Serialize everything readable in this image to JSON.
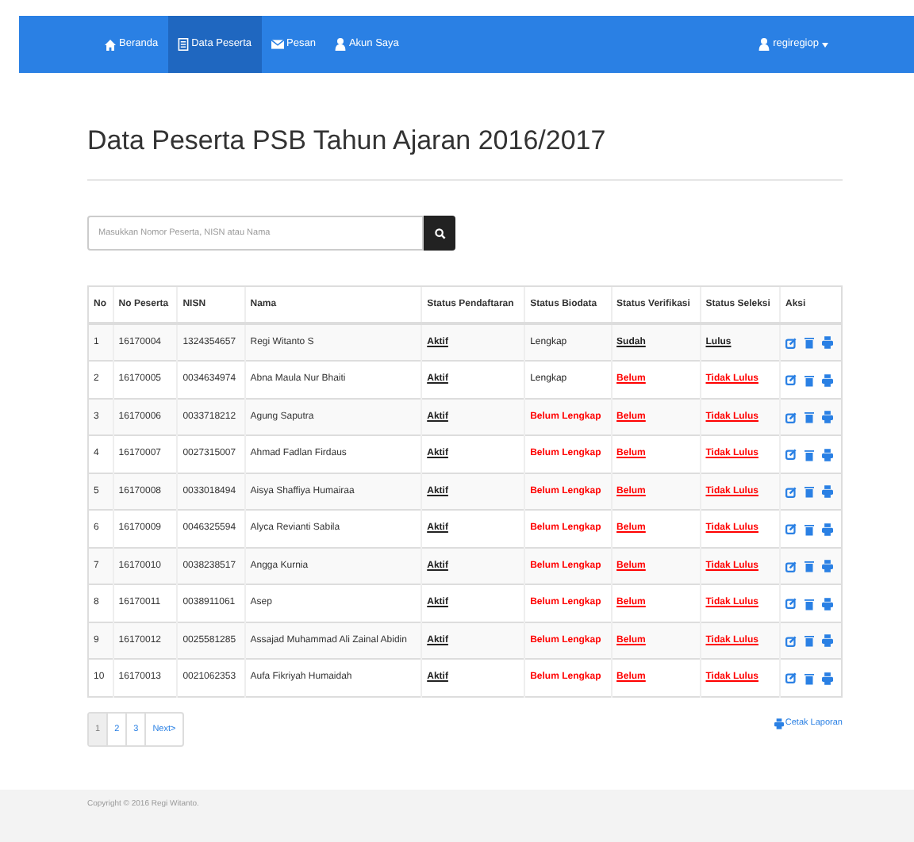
{
  "navbar": {
    "items": [
      {
        "label": "Beranda",
        "selected": false
      },
      {
        "label": "Data Peserta",
        "selected": true
      },
      {
        "label": "Pesan",
        "selected": false
      },
      {
        "label": "Akun Saya",
        "selected": false
      }
    ],
    "user_menu": {
      "label": "regiregiop"
    }
  },
  "title": "Data Peserta PSB Tahun Ajaran 2016/2017",
  "search": {
    "placeholder": "Masukkan Nomor Peserta, NISN atau Nama"
  },
  "table": {
    "columns": [
      "No",
      "No Peserta",
      "NISN",
      "Nama",
      "Status Pendaftaran",
      "Status Biodata",
      "Status Verifikasi",
      "Status Seleksi",
      "Aksi"
    ],
    "rows": [
      {
        "no": "1",
        "no_peserta": "16170004",
        "nisn": "1324354657",
        "nama": "Regi Witanto S",
        "pendaftaran": {
          "text": "Aktif",
          "ok": true
        },
        "biodata": {
          "text": "Lengkap",
          "ok": true
        },
        "verifikasi": {
          "text": "Sudah",
          "ok": true
        },
        "seleksi": {
          "text": "Lulus",
          "ok": true
        }
      },
      {
        "no": "2",
        "no_peserta": "16170005",
        "nisn": "0034634974",
        "nama": "Abna Maula Nur Bhaiti",
        "pendaftaran": {
          "text": "Aktif",
          "ok": true
        },
        "biodata": {
          "text": "Lengkap",
          "ok": true
        },
        "verifikasi": {
          "text": "Belum",
          "ok": false
        },
        "seleksi": {
          "text": "Tidak Lulus",
          "ok": false
        }
      },
      {
        "no": "3",
        "no_peserta": "16170006",
        "nisn": "0033718212",
        "nama": "Agung Saputra",
        "pendaftaran": {
          "text": "Aktif",
          "ok": true
        },
        "biodata": {
          "text": "Belum Lengkap",
          "ok": false
        },
        "verifikasi": {
          "text": "Belum",
          "ok": false
        },
        "seleksi": {
          "text": "Tidak Lulus",
          "ok": false
        }
      },
      {
        "no": "4",
        "no_peserta": "16170007",
        "nisn": "0027315007",
        "nama": "Ahmad Fadlan Firdaus",
        "pendaftaran": {
          "text": "Aktif",
          "ok": true
        },
        "biodata": {
          "text": "Belum Lengkap",
          "ok": false
        },
        "verifikasi": {
          "text": "Belum",
          "ok": false
        },
        "seleksi": {
          "text": "Tidak Lulus",
          "ok": false
        }
      },
      {
        "no": "5",
        "no_peserta": "16170008",
        "nisn": "0033018494",
        "nama": "Aisya Shaffiya Humairaa",
        "pendaftaran": {
          "text": "Aktif",
          "ok": true
        },
        "biodata": {
          "text": "Belum Lengkap",
          "ok": false
        },
        "verifikasi": {
          "text": "Belum",
          "ok": false
        },
        "seleksi": {
          "text": "Tidak Lulus",
          "ok": false
        }
      },
      {
        "no": "6",
        "no_peserta": "16170009",
        "nisn": "0046325594",
        "nama": "Alyca Revianti Sabila",
        "pendaftaran": {
          "text": "Aktif",
          "ok": true
        },
        "biodata": {
          "text": "Belum Lengkap",
          "ok": false
        },
        "verifikasi": {
          "text": "Belum",
          "ok": false
        },
        "seleksi": {
          "text": "Tidak Lulus",
          "ok": false
        }
      },
      {
        "no": "7",
        "no_peserta": "16170010",
        "nisn": "0038238517",
        "nama": "Angga Kurnia",
        "pendaftaran": {
          "text": "Aktif",
          "ok": true
        },
        "biodata": {
          "text": "Belum Lengkap",
          "ok": false
        },
        "verifikasi": {
          "text": "Belum",
          "ok": false
        },
        "seleksi": {
          "text": "Tidak Lulus",
          "ok": false
        }
      },
      {
        "no": "8",
        "no_peserta": "16170011",
        "nisn": "0038911061",
        "nama": "Asep",
        "pendaftaran": {
          "text": "Aktif",
          "ok": true
        },
        "biodata": {
          "text": "Belum Lengkap",
          "ok": false
        },
        "verifikasi": {
          "text": "Belum",
          "ok": false
        },
        "seleksi": {
          "text": "Tidak Lulus",
          "ok": false
        }
      },
      {
        "no": "9",
        "no_peserta": "16170012",
        "nisn": "0025581285",
        "nama": "Assajad Muhammad Ali Zainal Abidin",
        "pendaftaran": {
          "text": "Aktif",
          "ok": true
        },
        "biodata": {
          "text": "Belum Lengkap",
          "ok": false
        },
        "verifikasi": {
          "text": "Belum",
          "ok": false
        },
        "seleksi": {
          "text": "Tidak Lulus",
          "ok": false
        }
      },
      {
        "no": "10",
        "no_peserta": "16170013",
        "nisn": "0021062353",
        "nama": "Aufa Fikriyah Humaidah",
        "pendaftaran": {
          "text": "Aktif",
          "ok": true
        },
        "biodata": {
          "text": "Belum Lengkap",
          "ok": false
        },
        "verifikasi": {
          "text": "Belum",
          "ok": false
        },
        "seleksi": {
          "text": "Tidak Lulus",
          "ok": false
        }
      }
    ]
  },
  "pagination": [
    {
      "label": "1",
      "selected": true
    },
    {
      "label": "2",
      "selected": false
    },
    {
      "label": "3",
      "selected": false
    },
    {
      "label": "Next>",
      "selected": false
    }
  ],
  "report_link": "Cetak Laporan",
  "footer": "Copyright © 2016 Regi Witanto."
}
